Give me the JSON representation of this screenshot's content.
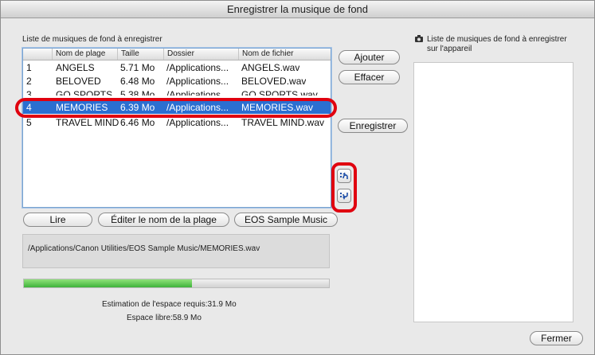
{
  "window": {
    "title": "Enregistrer la musique de fond"
  },
  "left": {
    "list_label": "Liste de musiques de fond à enregistrer",
    "columns": [
      "",
      "Nom de plage",
      "Taille",
      "Dossier",
      "Nom de fichier"
    ],
    "rows": [
      {
        "num": "1",
        "name": "ANGELS",
        "size": "5.71 Mo",
        "folder": "/Applications...",
        "file": "ANGELS.wav"
      },
      {
        "num": "2",
        "name": "BELOVED",
        "size": "6.48 Mo",
        "folder": "/Applications...",
        "file": "BELOVED.wav"
      },
      {
        "num": "3",
        "name": "GO SPORTS",
        "size": "5.38 Mo",
        "folder": "/Applications...",
        "file": "GO SPORTS.wav"
      },
      {
        "num": "4",
        "name": "MEMORIES",
        "size": "6.39 Mo",
        "folder": "/Applications...",
        "file": "MEMORIES.wav"
      },
      {
        "num": "5",
        "name": "TRAVEL MIND",
        "size": "6.46 Mo",
        "folder": "/Applications...",
        "file": "TRAVEL MIND.wav"
      }
    ],
    "selected_index": 3
  },
  "buttons": {
    "add": "Ajouter",
    "delete": "Effacer",
    "save": "Enregistrer",
    "play": "Lire",
    "edit_name": "Éditer le nom de la plage",
    "sample": "EOS Sample Music",
    "close": "Fermer"
  },
  "path": "/Applications/Canon Utilities/EOS Sample Music/MEMORIES.wav",
  "progress": {
    "fraction": 0.55,
    "color": "#3fb33a"
  },
  "space": {
    "required": "Estimation de l'espace requis:31.9 Mo",
    "free": "Espace libre:58.9 Mo"
  },
  "right": {
    "label_line1": "Liste de musiques de fond à enregistrer",
    "label_line2": "sur l'appareil"
  },
  "colors": {
    "selection": "#2b6fd1",
    "highlight": "#e0000f"
  }
}
